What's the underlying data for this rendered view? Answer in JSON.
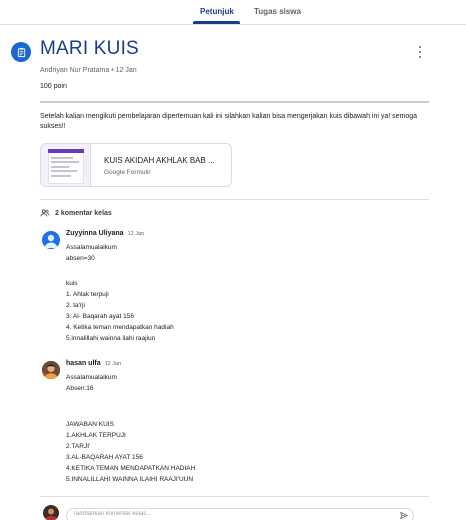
{
  "tabs": [
    {
      "label": "Petunjuk",
      "active": true
    },
    {
      "label": "Tugas siswa",
      "active": false
    }
  ],
  "assignment": {
    "icon": "assignment-icon",
    "title": "MARI KUIS",
    "meta": "Andriyan Nur Pratama • 12 Jan",
    "points": "100 poin",
    "description": "Setelah kalian mengikuti pembelajaran dipertemuan kali ini silahkan kalian bisa mengerjakan kuis dibawah ini ya! semoga sukses!!",
    "attachment": {
      "title": "KUIS AKIDAH AKHLAK BAB ...",
      "subtitle": "Google Formulir"
    }
  },
  "comments_header": "2 komentar kelas",
  "comments": [
    {
      "author": "Zuyyinna Uliyana",
      "date": "12 Jan",
      "lines": [
        "Assalamualaikum",
        "absen=30",
        "",
        "kuis",
        "1. Ahlak terpuji",
        "2.  ta'rji",
        "3. Al- Baqarah ayat 156",
        "4. Ketika teman mendapatkan hadiah",
        "5.innalillahi wainna ilahi raajiun"
      ]
    },
    {
      "author": "hasan ulfa",
      "date": "12 Jan",
      "lines": [
        "Assalamualaikum",
        "Absen:16",
        "",
        "",
        "JAWABAN KUIS",
        "1.AKHLAK TERPUJI",
        "2.TARJI'",
        "3.AL-BAQARAH AYAT 156",
        "4.KETIKA TEMAN MENDAPATKAN HADIAH",
        "5.INNALILLAHI WAINNA ILAIHI RAAJI'UUN"
      ]
    }
  ],
  "reply": {
    "placeholder": "Tambahkan komentar kelas..."
  },
  "colors": {
    "primary": "#1a3c8c",
    "accent": "#1967d2",
    "forms_purple": "#673ab7"
  }
}
